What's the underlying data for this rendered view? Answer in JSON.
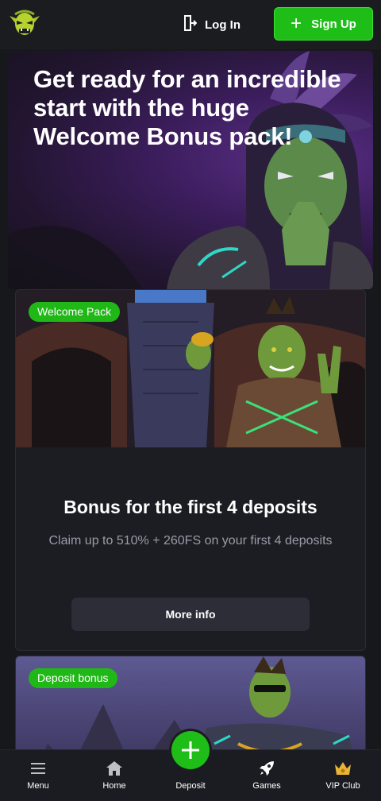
{
  "header": {
    "login_label": "Log In",
    "signup_label": "Sign Up"
  },
  "hero": {
    "title": "Get ready for an incredible start with the huge Welcome Bonus pack!"
  },
  "promos": [
    {
      "badge": "Welcome Pack",
      "title": "Bonus for the first 4 deposits",
      "subtitle": "Claim up to 510% + 260FS on your first 4 deposits",
      "button": "More info"
    },
    {
      "badge": "Deposit bonus"
    }
  ],
  "bottom_nav": {
    "items": [
      {
        "label": "Menu",
        "icon": "menu-icon"
      },
      {
        "label": "Home",
        "icon": "home-icon"
      },
      {
        "label": "Deposit",
        "icon": "plus-icon"
      },
      {
        "label": "Games",
        "icon": "rocket-icon"
      },
      {
        "label": "VIP Club",
        "icon": "crown-icon"
      }
    ]
  },
  "colors": {
    "accent_green": "#1fbd17",
    "background": "#17181c",
    "card": "#1c1d23"
  }
}
